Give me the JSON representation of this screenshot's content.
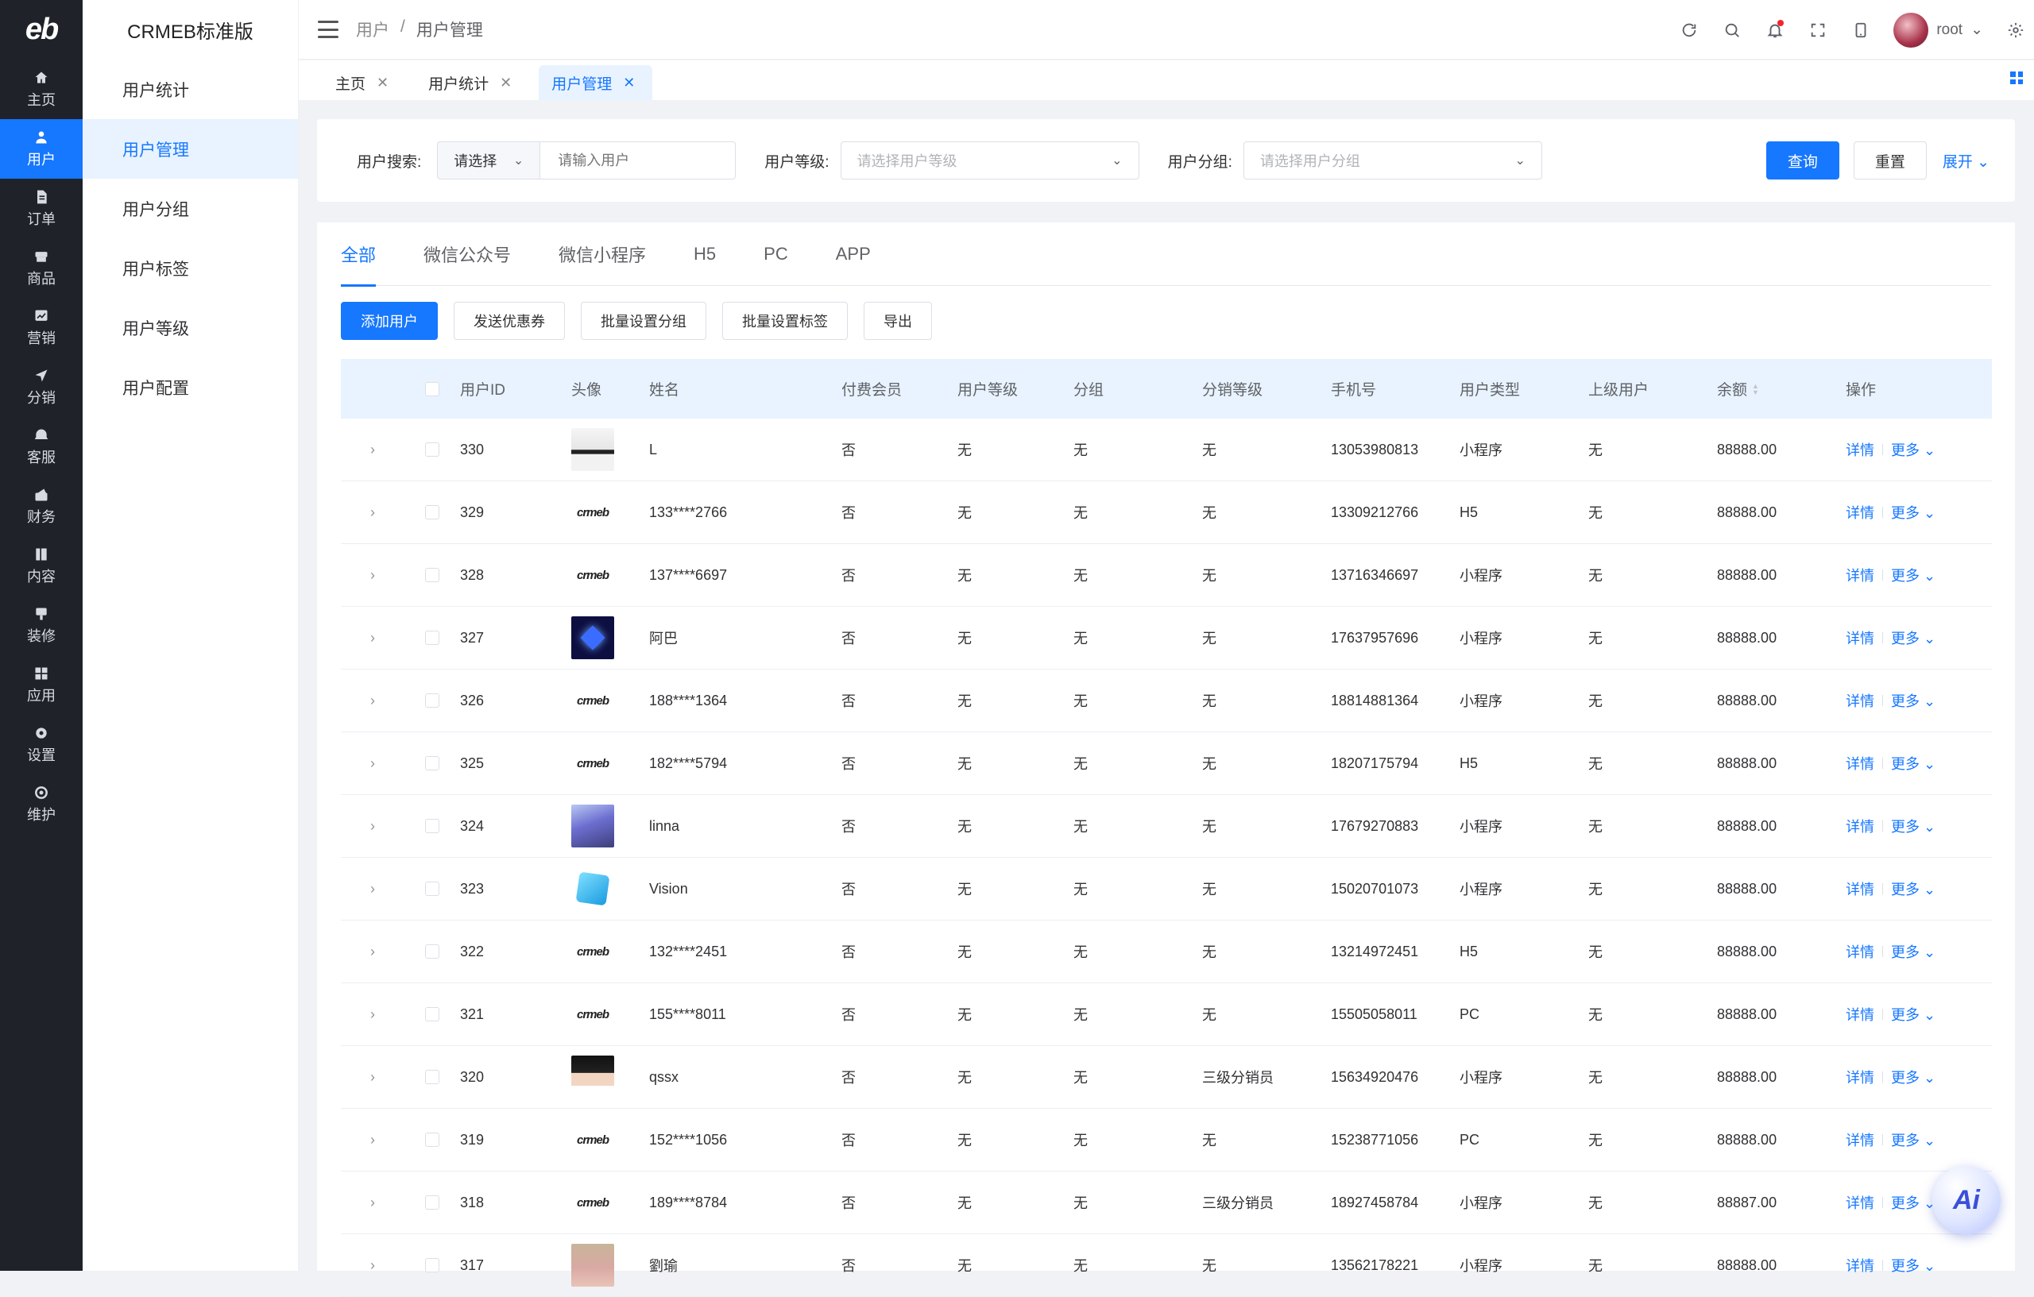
{
  "rail": {
    "logo": "eb",
    "items": [
      {
        "label": "主页",
        "icon": "home-icon"
      },
      {
        "label": "用户",
        "icon": "user-icon",
        "active": true
      },
      {
        "label": "订单",
        "icon": "order-icon"
      },
      {
        "label": "商品",
        "icon": "goods-icon"
      },
      {
        "label": "营销",
        "icon": "marketing-icon"
      },
      {
        "label": "分销",
        "icon": "distribution-icon"
      },
      {
        "label": "客服",
        "icon": "service-icon"
      },
      {
        "label": "财务",
        "icon": "finance-icon"
      },
      {
        "label": "内容",
        "icon": "content-icon"
      },
      {
        "label": "装修",
        "icon": "decorate-icon"
      },
      {
        "label": "应用",
        "icon": "apps-icon"
      },
      {
        "label": "设置",
        "icon": "settings-icon"
      },
      {
        "label": "维护",
        "icon": "maintain-icon"
      }
    ]
  },
  "submenu": {
    "title": "CRMEB标准版",
    "items": [
      "用户统计",
      "用户管理",
      "用户分组",
      "用户标签",
      "用户等级",
      "用户配置"
    ]
  },
  "header": {
    "breadcrumb": [
      "用户",
      "/",
      "用户管理"
    ],
    "username": "root"
  },
  "tags": [
    {
      "label": "主页",
      "close": "✕"
    },
    {
      "label": "用户统计",
      "close": "✕"
    },
    {
      "label": "用户管理",
      "close": "✕",
      "active": true
    }
  ],
  "search": {
    "user_label": "用户搜索:",
    "user_type_select": "请选择",
    "user_placeholder": "请输入用户",
    "level_label": "用户等级:",
    "level_placeholder": "请选择用户等级",
    "group_label": "用户分组:",
    "group_placeholder": "请选择用户分组",
    "query": "查询",
    "reset": "重置",
    "expand": "展开"
  },
  "platform_tabs": [
    "全部",
    "微信公众号",
    "微信小程序",
    "H5",
    "PC",
    "APP"
  ],
  "actions": [
    "添加用户",
    "发送优惠券",
    "批量设置分组",
    "批量设置标签",
    "导出"
  ],
  "table": {
    "columns": [
      "用户ID",
      "头像",
      "姓名",
      "付费会员",
      "用户等级",
      "分组",
      "分销等级",
      "手机号",
      "用户类型",
      "上级用户",
      "余额",
      "操作"
    ],
    "op_detail": "详情",
    "op_more": "更多",
    "rows": [
      {
        "id": "330",
        "avatar": "photo1",
        "name": "L",
        "vip": "否",
        "level": "无",
        "group": "无",
        "dlevel": "无",
        "phone": "13053980813",
        "type": "小程序",
        "up": "无",
        "balance": "88888.00"
      },
      {
        "id": "329",
        "avatar": "logo",
        "name": "133****2766",
        "vip": "否",
        "level": "无",
        "group": "无",
        "dlevel": "无",
        "phone": "13309212766",
        "type": "H5",
        "up": "无",
        "balance": "88888.00"
      },
      {
        "id": "328",
        "avatar": "logo",
        "name": "137****6697",
        "vip": "否",
        "level": "无",
        "group": "无",
        "dlevel": "无",
        "phone": "13716346697",
        "type": "小程序",
        "up": "无",
        "balance": "88888.00"
      },
      {
        "id": "327",
        "avatar": "heart",
        "name": "阿巴",
        "vip": "否",
        "level": "无",
        "group": "无",
        "dlevel": "无",
        "phone": "17637957696",
        "type": "小程序",
        "up": "无",
        "balance": "88888.00"
      },
      {
        "id": "326",
        "avatar": "logo",
        "name": "188****1364",
        "vip": "否",
        "level": "无",
        "group": "无",
        "dlevel": "无",
        "phone": "18814881364",
        "type": "小程序",
        "up": "无",
        "balance": "88888.00"
      },
      {
        "id": "325",
        "avatar": "logo",
        "name": "182****5794",
        "vip": "否",
        "level": "无",
        "group": "无",
        "dlevel": "无",
        "phone": "18207175794",
        "type": "H5",
        "up": "无",
        "balance": "88888.00"
      },
      {
        "id": "324",
        "avatar": "anime",
        "name": "linna",
        "vip": "否",
        "level": "无",
        "group": "无",
        "dlevel": "无",
        "phone": "17679270883",
        "type": "小程序",
        "up": "无",
        "balance": "88888.00"
      },
      {
        "id": "323",
        "avatar": "cube",
        "name": "Vision",
        "vip": "否",
        "level": "无",
        "group": "无",
        "dlevel": "无",
        "phone": "15020701073",
        "type": "小程序",
        "up": "无",
        "balance": "88888.00"
      },
      {
        "id": "322",
        "avatar": "logo",
        "name": "132****2451",
        "vip": "否",
        "level": "无",
        "group": "无",
        "dlevel": "无",
        "phone": "13214972451",
        "type": "H5",
        "up": "无",
        "balance": "88888.00"
      },
      {
        "id": "321",
        "avatar": "logo",
        "name": "155****8011",
        "vip": "否",
        "level": "无",
        "group": "无",
        "dlevel": "无",
        "phone": "15505058011",
        "type": "PC",
        "up": "无",
        "balance": "88888.00"
      },
      {
        "id": "320",
        "avatar": "boy",
        "name": "qssx",
        "vip": "否",
        "level": "无",
        "group": "无",
        "dlevel": "三级分销员",
        "phone": "15634920476",
        "type": "小程序",
        "up": "无",
        "balance": "88888.00"
      },
      {
        "id": "319",
        "avatar": "logo",
        "name": "152****1056",
        "vip": "否",
        "level": "无",
        "group": "无",
        "dlevel": "无",
        "phone": "15238771056",
        "type": "PC",
        "up": "无",
        "balance": "88888.00"
      },
      {
        "id": "318",
        "avatar": "logo",
        "name": "189****8784",
        "vip": "否",
        "level": "无",
        "group": "无",
        "dlevel": "三级分销员",
        "phone": "18927458784",
        "type": "小程序",
        "up": "无",
        "balance": "88887.00"
      },
      {
        "id": "317",
        "avatar": "pig",
        "name": "劉瑜",
        "vip": "否",
        "level": "无",
        "group": "无",
        "dlevel": "无",
        "phone": "13562178221",
        "type": "小程序",
        "up": "无",
        "balance": "88888.00"
      }
    ]
  },
  "avatar_logo_text": "crmeb",
  "ai_label": "Ai",
  "colors": {
    "primary": "#1677ff",
    "rail_bg": "#1f2329",
    "header_row_bg": "#e8f3ff"
  }
}
